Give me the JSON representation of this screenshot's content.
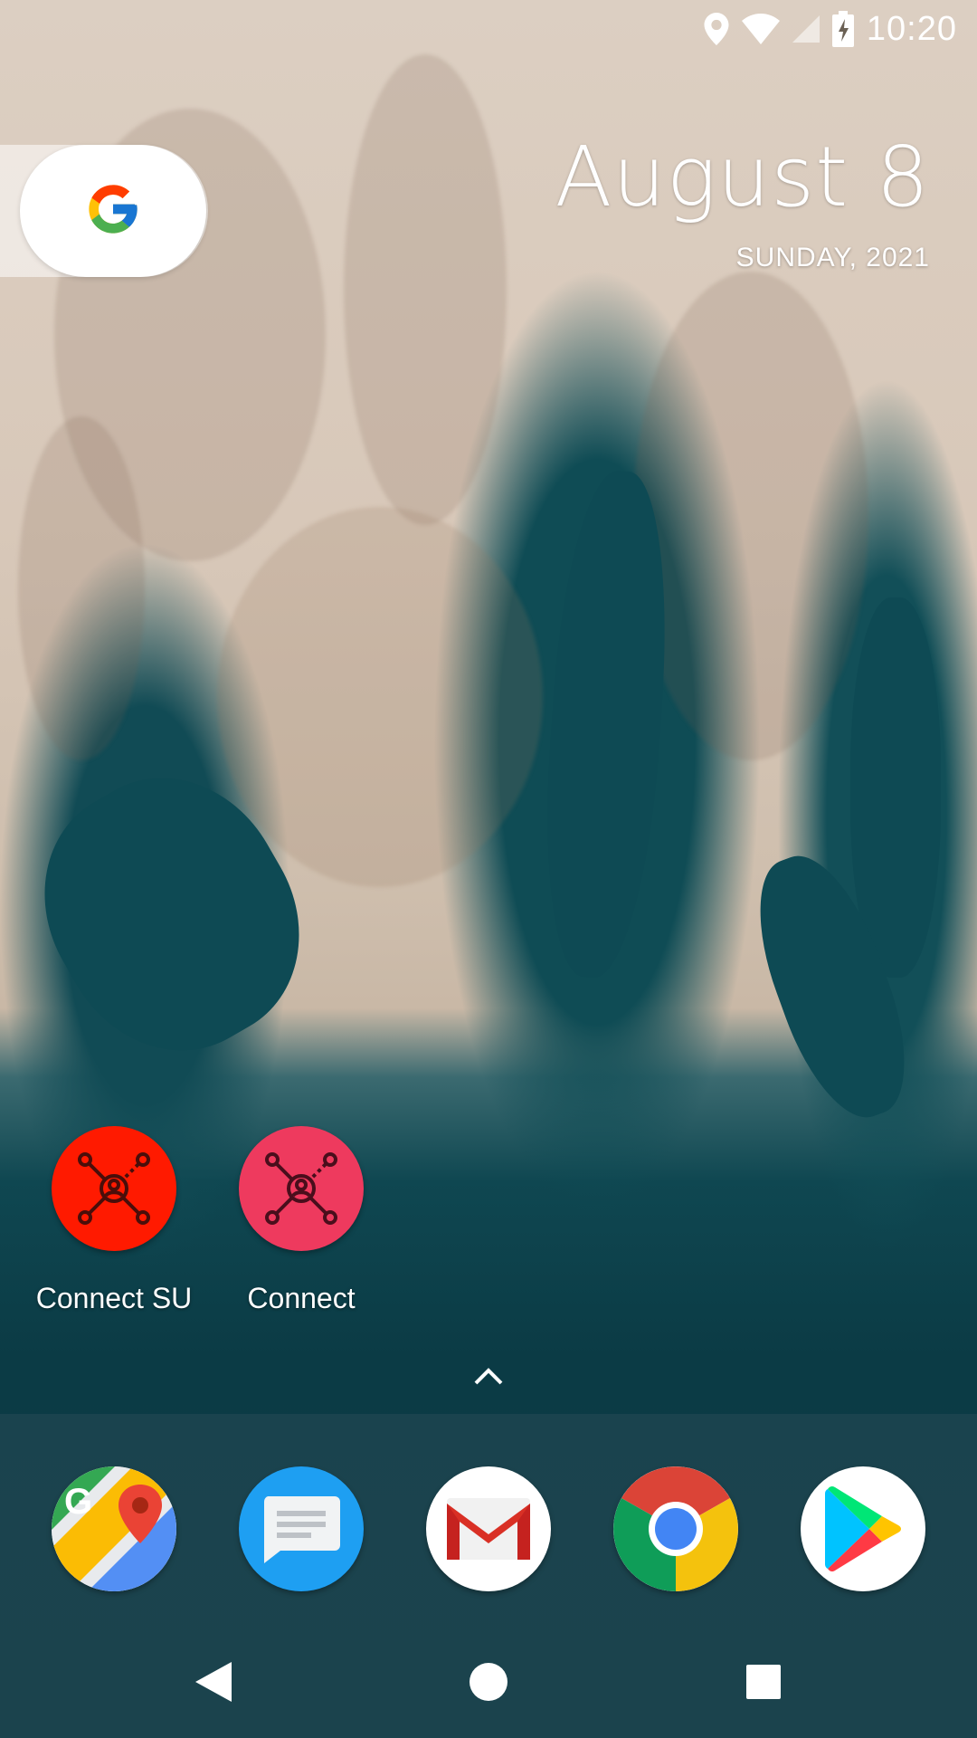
{
  "status_bar": {
    "time": "10:20",
    "icons": [
      "location-icon",
      "wifi-icon",
      "cell-signal-icon",
      "battery-charging-icon"
    ]
  },
  "search_widget": {
    "icon": "google-g-icon"
  },
  "date_widget": {
    "date": "August 8",
    "weekday_year": "SUNDAY, 2021"
  },
  "home_apps": [
    {
      "label": "Connect SU",
      "icon": "connect-network-icon",
      "color": "#ff1a00"
    },
    {
      "label": "Connect",
      "icon": "connect-network-icon",
      "color": "#ee3a5e"
    }
  ],
  "app_drawer": {
    "icon": "chevron-up-icon"
  },
  "dock": [
    {
      "name": "Maps",
      "icon": "google-maps-icon"
    },
    {
      "name": "Messages",
      "icon": "messages-icon",
      "color": "#1e9ff2"
    },
    {
      "name": "Gmail",
      "icon": "gmail-icon"
    },
    {
      "name": "Chrome",
      "icon": "chrome-icon"
    },
    {
      "name": "Play Store",
      "icon": "play-store-icon"
    }
  ],
  "nav_bar": {
    "buttons": [
      "back-icon",
      "home-icon",
      "recents-icon"
    ]
  }
}
